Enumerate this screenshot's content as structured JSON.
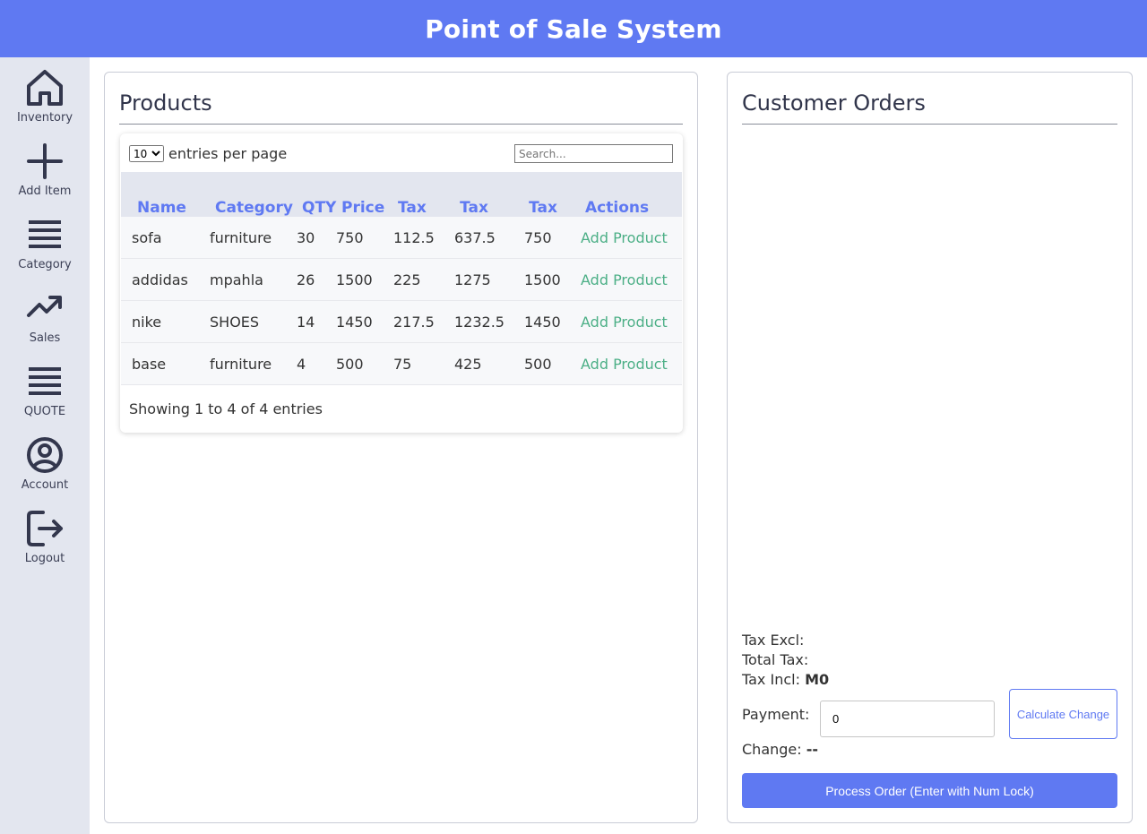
{
  "app": {
    "title": "Point of Sale System"
  },
  "colors": {
    "accent": "#5f79f2",
    "sidebar_bg": "#e3e6ef",
    "action_green": "#4caf86"
  },
  "sidebar": {
    "items": [
      {
        "label": "Inventory",
        "icon": "home-icon"
      },
      {
        "label": "Add Item",
        "icon": "plus-icon"
      },
      {
        "label": "Category",
        "icon": "menu-lines-icon"
      },
      {
        "label": "Sales",
        "icon": "trending-up-icon"
      },
      {
        "label": "QUOTE",
        "icon": "menu-lines-icon"
      },
      {
        "label": "Account",
        "icon": "user-circle-icon"
      },
      {
        "label": "Logout",
        "icon": "logout-icon"
      }
    ]
  },
  "products": {
    "title": "Products",
    "entries_select_value": "10",
    "entries_label": "entries per page",
    "search_placeholder": "Search...",
    "columns": [
      "Name",
      "Category",
      "QTY",
      "Price",
      "Tax",
      "Tax Excl",
      "Tax Incl",
      "Actions"
    ],
    "rows": [
      {
        "name": "sofa",
        "category": "furniture",
        "qty": "30",
        "price": "750",
        "tax": "112.5",
        "tax_excl": "637.5",
        "tax_incl": "750",
        "action": "Add Product"
      },
      {
        "name": "addidas",
        "category": "mpahla",
        "qty": "26",
        "price": "1500",
        "tax": "225",
        "tax_excl": "1275",
        "tax_incl": "1500",
        "action": "Add Product"
      },
      {
        "name": "nike",
        "category": "SHOES",
        "qty": "14",
        "price": "1450",
        "tax": "217.5",
        "tax_excl": "1232.5",
        "tax_incl": "1450",
        "action": "Add Product"
      },
      {
        "name": "base",
        "category": "furniture",
        "qty": "4",
        "price": "500",
        "tax": "75",
        "tax_excl": "425",
        "tax_incl": "500",
        "action": "Add Product"
      }
    ],
    "info": "Showing 1 to 4 of 4 entries"
  },
  "orders": {
    "title": "Customer Orders",
    "tax_excl_label": "Tax Excl:",
    "total_tax_label": "Total Tax:",
    "tax_incl_label": "Tax Incl:",
    "tax_incl_value": "M0",
    "payment_label": "Payment:",
    "payment_value": "0",
    "calculate_label": "Calculate Change",
    "change_label": "Change:",
    "change_value": "--",
    "process_label": "Process Order (Enter with Num Lock)"
  }
}
